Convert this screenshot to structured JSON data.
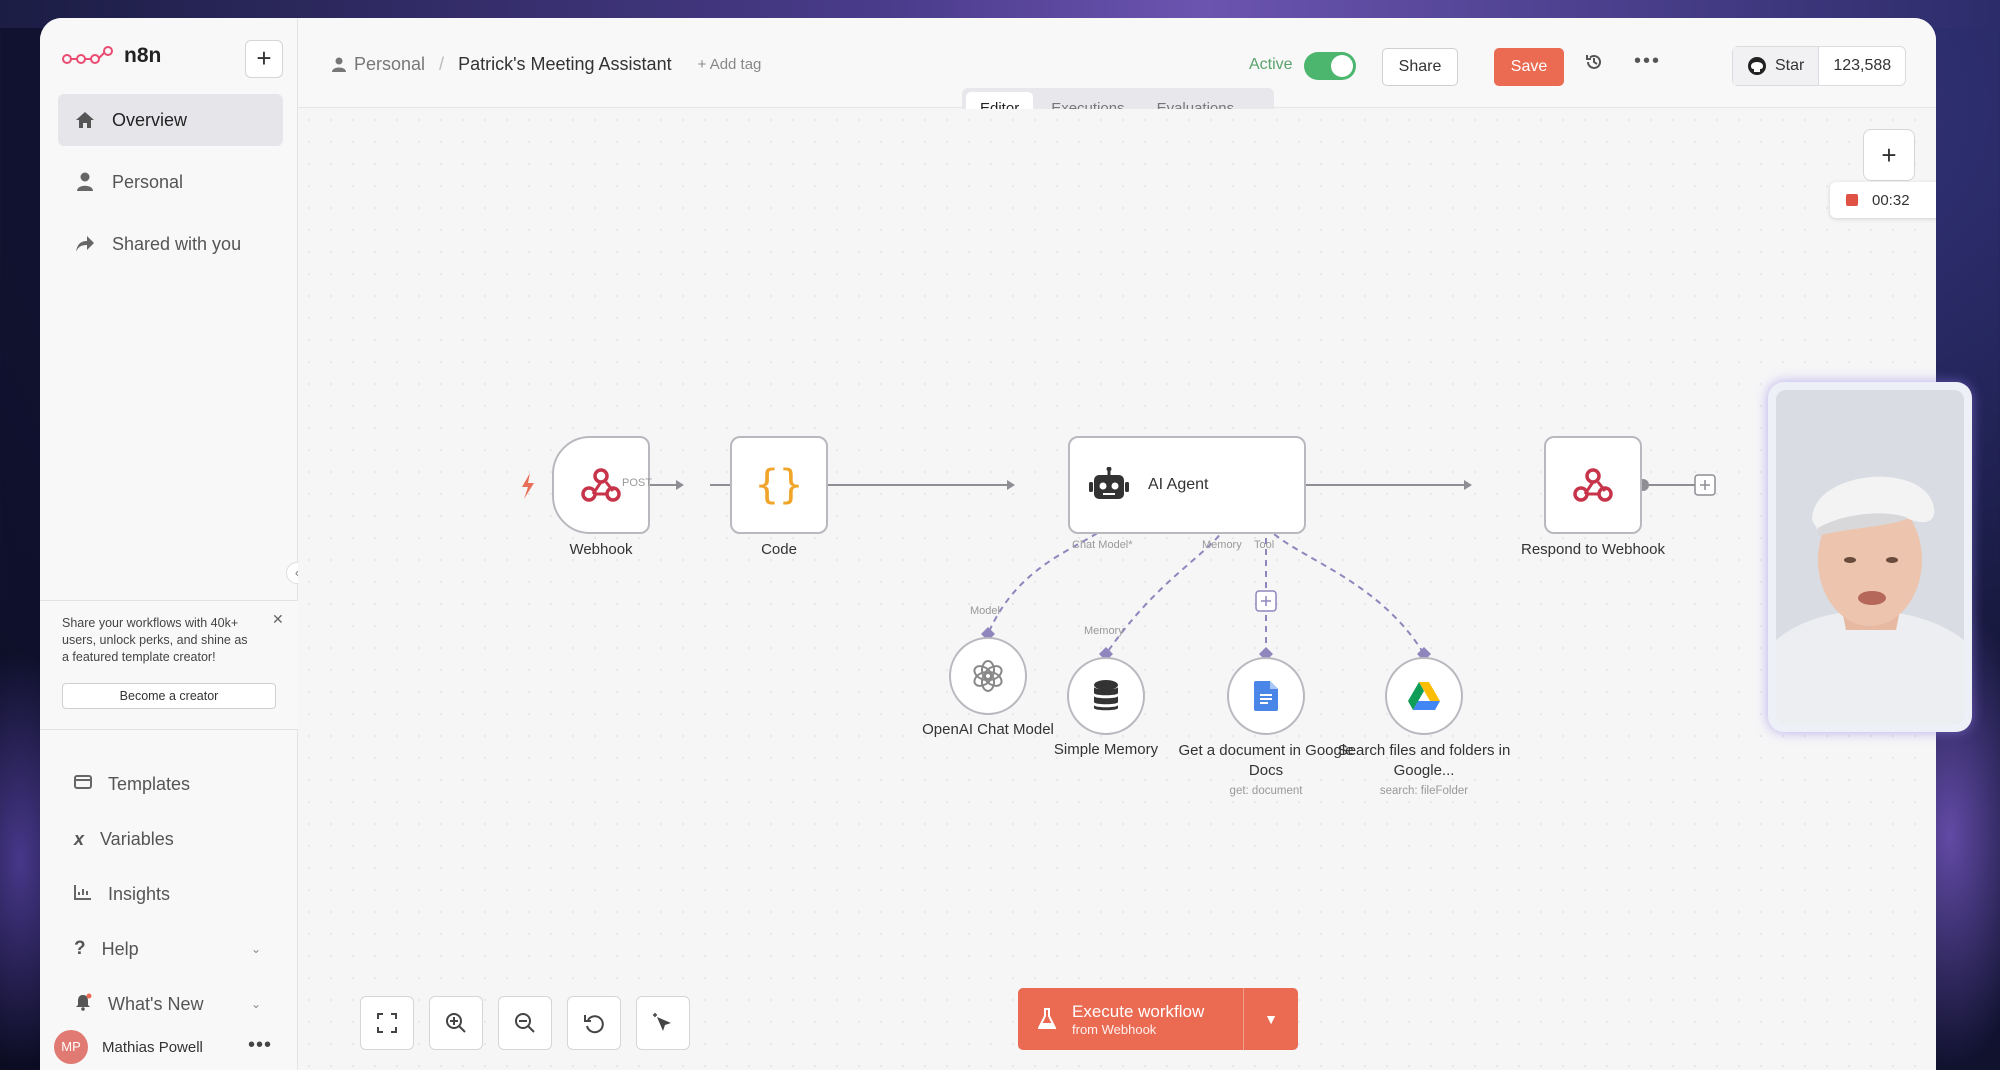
{
  "app": {
    "name": "n8n"
  },
  "sidebar": {
    "items": [
      {
        "label": "Overview"
      },
      {
        "label": "Personal"
      },
      {
        "label": "Shared with you"
      }
    ],
    "promo": {
      "text": "Share your workflows with 40k+ users, unlock perks, and shine as a featured template creator!",
      "button": "Become a creator"
    },
    "bottom_items": [
      {
        "label": "Templates"
      },
      {
        "label": "Variables"
      },
      {
        "label": "Insights"
      },
      {
        "label": "Help"
      },
      {
        "label": "What's New"
      }
    ],
    "user": {
      "initials": "MP",
      "name": "Mathias Powell"
    }
  },
  "header": {
    "breadcrumb_home": "Personal",
    "workflow_title": "Patrick's Meeting Assistant",
    "add_tag": "+ Add tag",
    "active_label": "Active",
    "share_label": "Share",
    "save_label": "Save",
    "github_star": "Star",
    "github_count": "123,588"
  },
  "tabs": [
    {
      "label": "Editor"
    },
    {
      "label": "Executions"
    },
    {
      "label": "Evaluations"
    }
  ],
  "recording": {
    "time": "00:32"
  },
  "nodes": {
    "webhook": {
      "label": "Webhook",
      "port": "POST"
    },
    "code": {
      "label": "Code"
    },
    "agent": {
      "label": "AI Agent",
      "port_chat": "Chat Model*",
      "port_memory": "Memory",
      "port_tool": "Tool"
    },
    "respond": {
      "label": "Respond to Webhook"
    },
    "openai": {
      "label": "OpenAI Chat Model",
      "port": "Model"
    },
    "memory": {
      "label": "Simple Memory",
      "port": "Memory"
    },
    "gdocs": {
      "label": "Get a document in Google Docs",
      "sub": "get: document"
    },
    "gdrive": {
      "label": "Search files and folders in Google...",
      "sub": "search: fileFolder"
    }
  },
  "execute": {
    "title": "Execute workflow",
    "sub": "from Webhook"
  },
  "colors": {
    "accent": "#eb6a52",
    "active": "#4cb66f",
    "connector": "#8f86bd"
  }
}
